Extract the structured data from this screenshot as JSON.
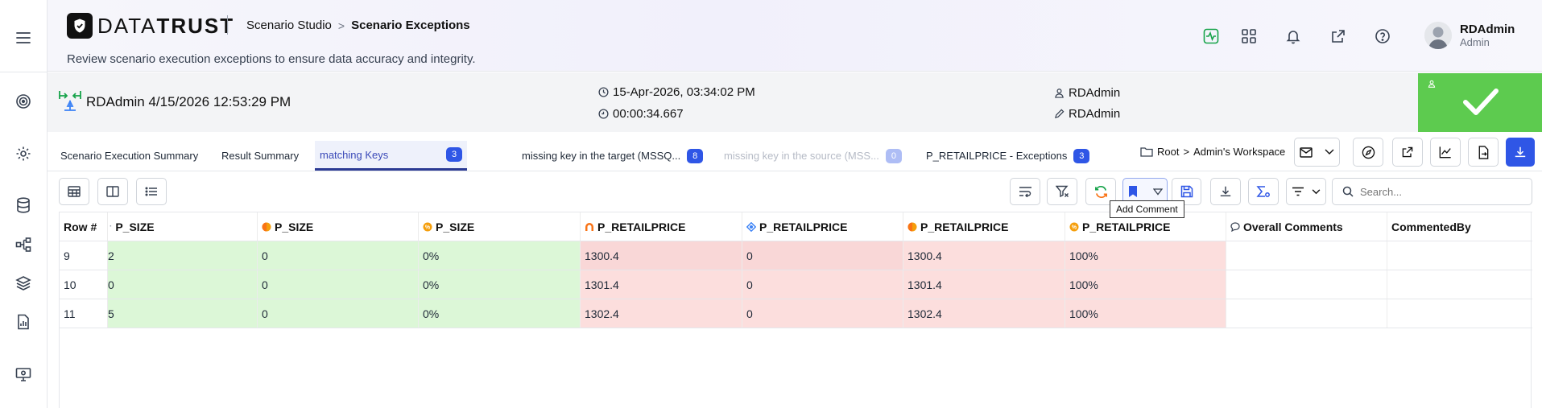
{
  "header": {
    "logo_prefix": "DATA",
    "logo_suffix": "TRUST",
    "breadcrumb_parent": "Scenario Studio",
    "breadcrumb_separator": ">",
    "breadcrumb_current": "Scenario Exceptions",
    "subtitle": "Review scenario execution exceptions to ensure data accuracy and integrity.",
    "user_name": "RDAdmin",
    "user_role": "Admin",
    "icons": [
      "activity-icon",
      "grid-apps-icon",
      "bell-icon",
      "external-link-icon",
      "help-icon"
    ]
  },
  "sidebar": {
    "items": [
      "menu-icon",
      "target-icon",
      "settings-icon",
      "database-icon",
      "flow-icon",
      "layers-icon",
      "report-icon",
      "monitor-icon"
    ]
  },
  "run": {
    "title": "RDAdmin 4/15/2026 12:53:29 PM",
    "started_at": "15-Apr-2026, 03:34:02 PM",
    "duration": "00:00:34.667",
    "created_by": "RDAdmin",
    "modified_by": "RDAdmin",
    "status_color": "#5dcb4f"
  },
  "tabs": [
    {
      "label": "Scenario Execution Summary"
    },
    {
      "label": "Result Summary"
    },
    {
      "label": "matching Keys",
      "count": "3"
    },
    {
      "label": "missing key in the target (MSSQ...",
      "count": "8"
    },
    {
      "label": "missing key in the source (MSS...",
      "count": "0"
    },
    {
      "label": "P_RETAILPRICE - Exceptions",
      "count": "3"
    }
  ],
  "workspace": {
    "root": "Root",
    "separator": ">",
    "name": "Admin's Workspace"
  },
  "toolbar": {
    "search_placeholder": "Search...",
    "tooltip": "Add Comment"
  },
  "table": {
    "columns": [
      "Row #",
      "P_SIZE",
      "P_SIZE",
      "P_SIZE",
      "P_RETAILPRICE",
      "P_RETAILPRICE",
      "P_RETAILPRICE",
      "P_RETAILPRICE",
      "Overall Comments",
      "CommentedBy"
    ],
    "rows": [
      [
        "9",
        "2",
        "0",
        "0%",
        "1300.4",
        "0",
        "1300.4",
        "100%",
        "",
        ""
      ],
      [
        "10",
        "0",
        "0",
        "0%",
        "1301.4",
        "0",
        "1301.4",
        "100%",
        "",
        ""
      ],
      [
        "11",
        "5",
        "0",
        "0%",
        "1302.4",
        "0",
        "1302.4",
        "100%",
        "",
        ""
      ]
    ]
  },
  "colors": {
    "match_green": "#dcf7d7",
    "mismatch_red": "#fcdedd",
    "accent_blue": "#2f56e6"
  }
}
